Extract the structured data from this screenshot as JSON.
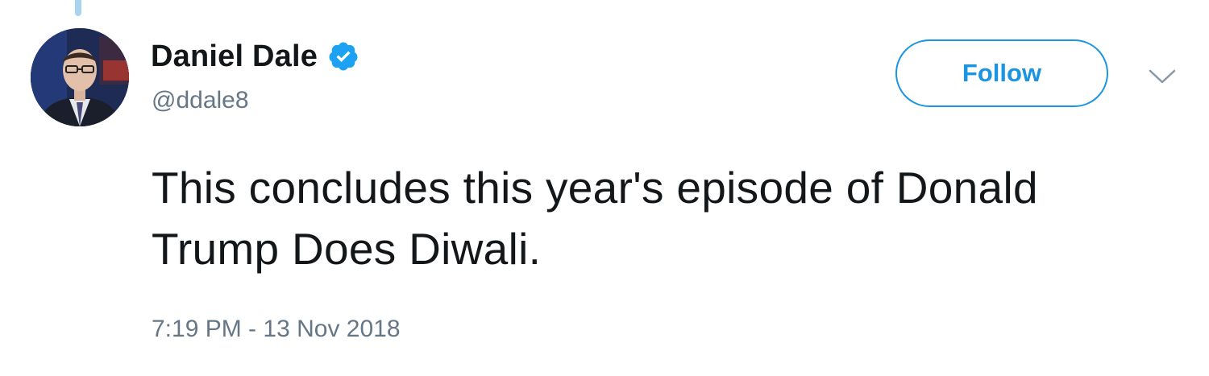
{
  "tweet": {
    "display_name": "Daniel Dale",
    "handle": "@ddale8",
    "verified": true,
    "follow_label": "Follow",
    "text": "This concludes this year's episode of Donald Trump Does Diwali.",
    "timestamp": "7:19 PM - 13 Nov 2018"
  },
  "icons": {
    "verified": "verified-badge-icon",
    "menu": "chevron-down-icon"
  },
  "colors": {
    "accent": "#1b95e0",
    "verified_badge": "#1da1f2",
    "secondary_text": "#657786",
    "primary_text": "#14171a",
    "thread_line": "#a9d3ee"
  }
}
